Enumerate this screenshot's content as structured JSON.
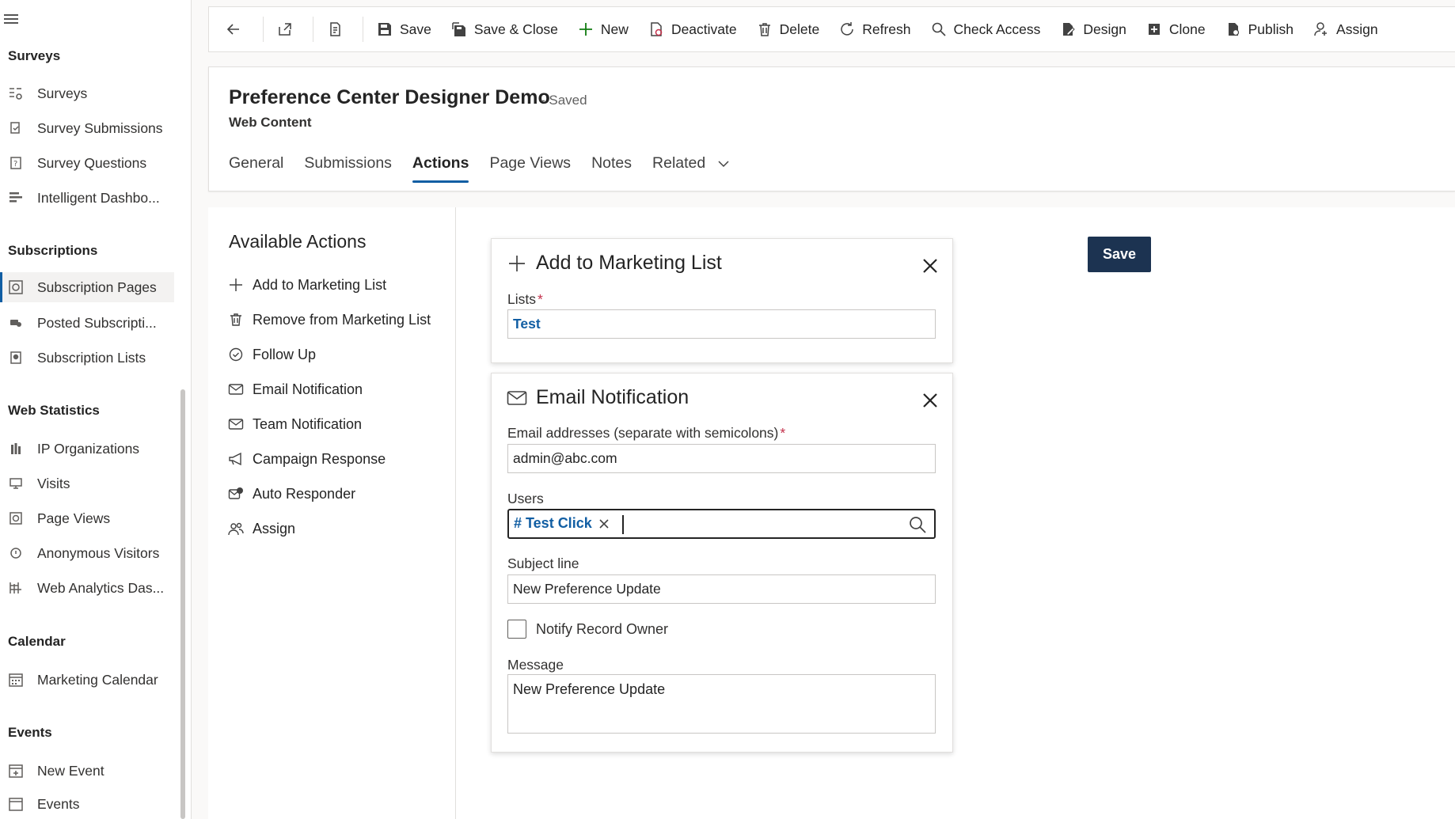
{
  "sidebar": {
    "groups": {
      "surveys": "Surveys",
      "subscriptions": "Subscriptions",
      "web_statistics": "Web Statistics",
      "calendar": "Calendar",
      "events": "Events"
    },
    "items": {
      "surveys": "Surveys",
      "survey_submissions": "Survey Submissions",
      "survey_questions": "Survey Questions",
      "intelligent_dashboard": "Intelligent Dashbo...",
      "subscription_pages": "Subscription Pages",
      "posted_subscriptions": "Posted Subscripti...",
      "subscription_lists": "Subscription Lists",
      "ip_organizations": "IP Organizations",
      "visits": "Visits",
      "page_views": "Page Views",
      "anonymous_visitors": "Anonymous Visitors",
      "web_analytics_dashboard": "Web Analytics Das...",
      "marketing_calendar": "Marketing Calendar",
      "new_event": "New Event",
      "events": "Events"
    }
  },
  "commandbar": {
    "save": "Save",
    "save_close": "Save & Close",
    "new": "New",
    "deactivate": "Deactivate",
    "delete": "Delete",
    "refresh": "Refresh",
    "check_access": "Check Access",
    "design": "Design",
    "clone": "Clone",
    "publish": "Publish",
    "assign": "Assign"
  },
  "header": {
    "title": "Preference Center Designer Demo",
    "status": "- Saved",
    "entity": "Web Content",
    "tabs": {
      "general": "General",
      "submissions": "Submissions",
      "actions": "Actions",
      "page_views": "Page Views",
      "notes": "Notes",
      "related": "Related"
    }
  },
  "available_actions": {
    "title": "Available Actions",
    "items": {
      "add_to_list": "Add to Marketing List",
      "remove_from_list": "Remove from Marketing List",
      "follow_up": "Follow Up",
      "email_notification": "Email Notification",
      "team_notification": "Team Notification",
      "campaign_response": "Campaign Response",
      "auto_responder": "Auto Responder",
      "assign": "Assign"
    }
  },
  "marketing_panel": {
    "title": "Add to Marketing List",
    "lists_label": "Lists",
    "required_mark": "*",
    "lists_value": "Test"
  },
  "email_panel": {
    "title": "Email Notification",
    "email_label": "Email addresses (separate with semicolons)",
    "required_mark": "*",
    "email_value": "admin@abc.com",
    "users_label": "Users",
    "user_tag": "# Test Click",
    "subject_label": "Subject line",
    "subject_value": "New Preference Update",
    "notify_owner_label": "Notify Record Owner",
    "notify_owner_checked": false,
    "message_label": "Message",
    "message_value": "New Preference Update"
  },
  "save_button": "Save",
  "colors": {
    "accent": "#115ea3",
    "primary_button": "#1c3351",
    "required": "#c4314b"
  }
}
